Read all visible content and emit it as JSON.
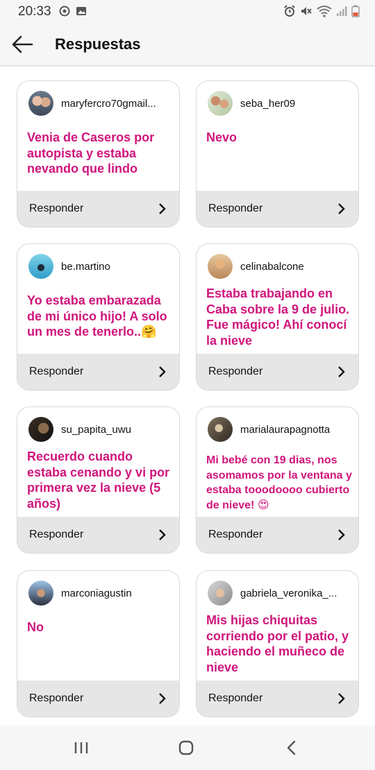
{
  "status": {
    "time": "20:33"
  },
  "header": {
    "title": "Respuestas"
  },
  "reply_label": "Responder",
  "cards": [
    {
      "user": "maryfercro70gmail...",
      "text": "Venia de Caseros por autopista y estaba nevando que lindo",
      "emoji": ""
    },
    {
      "user": "seba_her09",
      "text": "Nevo",
      "emoji": ""
    },
    {
      "user": "be.martino",
      "text": "Yo estaba embarazada de mi único hijo! A solo un mes de tenerlo..",
      "emoji": "🤗"
    },
    {
      "user": "celinabalcone",
      "text": "Estaba trabajando en Caba sobre la 9 de julio. Fue mágico! Ahí conocí la nieve",
      "emoji": ""
    },
    {
      "user": "su_papita_uwu",
      "text": "Recuerdo cuando estaba cenando y vi por primera vez la nieve (5 años)",
      "emoji": ""
    },
    {
      "user": "marialaurapagnotta",
      "text": "Mi bebé con 19 dias, nos asomamos por la ventana y estaba tooodoooo cubierto de nieve!",
      "emoji": "😍"
    },
    {
      "user": "marconiagustin",
      "text": "No",
      "emoji": ""
    },
    {
      "user": "gabriela_veronika_...",
      "text": "Mis hijas chiquitas corriendo por el patio, y haciendo el muñeco de nieve",
      "emoji": ""
    }
  ],
  "colors": {
    "accent": "#d0157c",
    "reply_bg": "#e6e6e6",
    "bar_bg": "#f6f6f6"
  }
}
